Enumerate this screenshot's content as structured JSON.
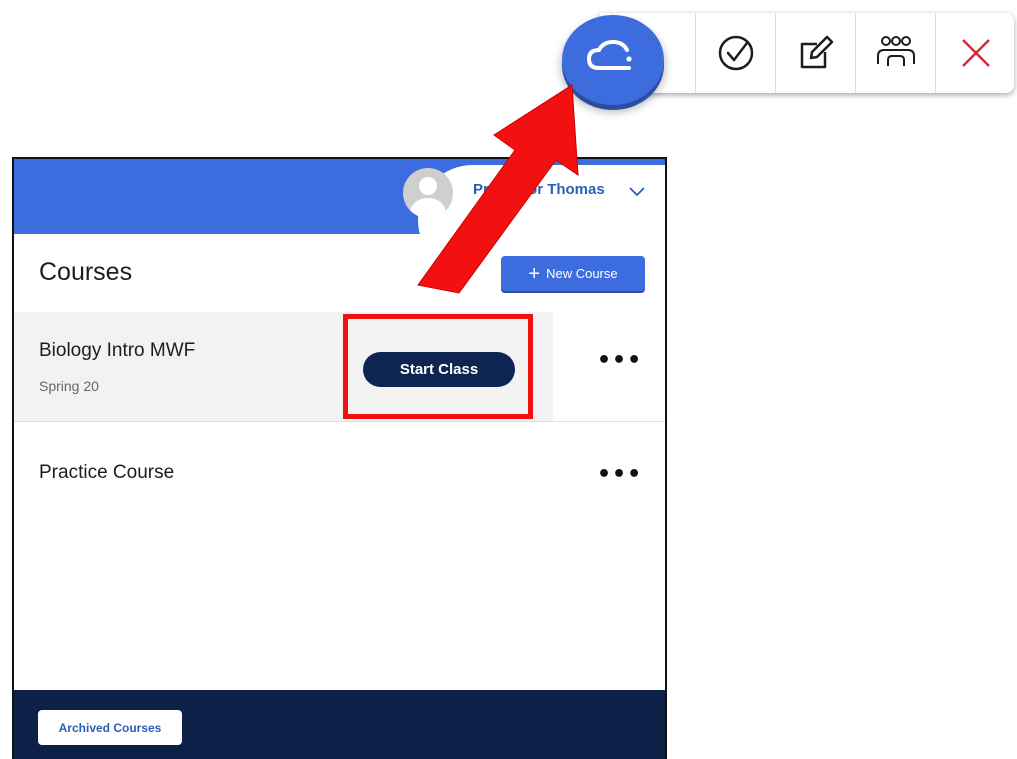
{
  "toolbar": {
    "cloud_button": {
      "icon": "cloud-icon",
      "color": "#3c6cde"
    },
    "buttons": [
      {
        "icon": "check-circle-icon"
      },
      {
        "icon": "edit-icon"
      },
      {
        "icon": "users-icon"
      },
      {
        "icon": "close-icon",
        "color": "#d7263d"
      }
    ]
  },
  "header": {
    "profile_name": "Professor Thomas",
    "avatar_icon": "user-avatar-icon",
    "chevron_icon": "chevron-down-icon",
    "color": "#3c6cde"
  },
  "main": {
    "title": "Courses",
    "new_course_label": "New Course",
    "new_course_icon": "plus-icon",
    "courses": [
      {
        "name": "Biology Intro MWF",
        "term": "Spring 20",
        "action_label": "Start Class",
        "more_icon": "more-horizontal-icon"
      },
      {
        "name": "Practice Course",
        "term": "",
        "more_icon": "more-horizontal-icon"
      }
    ]
  },
  "footer": {
    "archived_label": "Archived Courses",
    "color": "#0e1f48"
  },
  "annotation": {
    "highlight_color": "#f21010",
    "arrow_color": "#f21010"
  }
}
